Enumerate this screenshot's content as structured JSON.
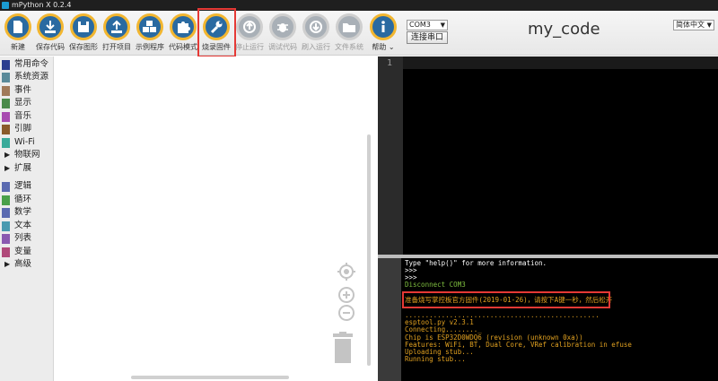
{
  "window": {
    "title": "mPython X 0.2.4"
  },
  "toolbar": {
    "buttons": [
      {
        "label": "新建",
        "icon": "new-file-icon",
        "enabled": true
      },
      {
        "label": "保存代码",
        "icon": "download-icon",
        "enabled": true
      },
      {
        "label": "保存图形",
        "icon": "floppy-icon",
        "enabled": true
      },
      {
        "label": "打开项目",
        "icon": "upload-icon",
        "enabled": true
      },
      {
        "label": "示例程序",
        "icon": "cubes-icon",
        "enabled": true
      },
      {
        "label": "代码模式",
        "icon": "puzzle-icon",
        "enabled": true
      },
      {
        "label": "烧录固件",
        "icon": "wrench-icon",
        "enabled": true
      },
      {
        "label": "停止运行",
        "icon": "upload-disabled-icon",
        "enabled": false
      },
      {
        "label": "调试代码",
        "icon": "bug-icon",
        "enabled": false
      },
      {
        "label": "刷入运行",
        "icon": "download-disabled-icon",
        "enabled": false
      },
      {
        "label": "文件系统",
        "icon": "folder-icon",
        "enabled": false
      },
      {
        "label": "帮助",
        "icon": "info-icon",
        "enabled": true
      }
    ],
    "port_value": "COM3",
    "connect_label": "连接串口",
    "file_name": "my_code",
    "language_value": "简体中文"
  },
  "sidebar": {
    "categories": [
      {
        "label": "常用命令",
        "color": "#2b3d8f",
        "expandable": false
      },
      {
        "label": "系统资源",
        "color": "#5a8a9a",
        "expandable": false
      },
      {
        "label": "事件",
        "color": "#a07a5a",
        "expandable": false
      },
      {
        "label": "显示",
        "color": "#4a8a4a",
        "expandable": false
      },
      {
        "label": "音乐",
        "color": "#a84ab0",
        "expandable": false
      },
      {
        "label": "引脚",
        "color": "#8a5a2a",
        "expandable": false
      },
      {
        "label": "Wi-Fi",
        "color": "#3aaa9a",
        "expandable": false
      },
      {
        "label": "物联网",
        "color": "",
        "expandable": true
      },
      {
        "label": "扩展",
        "color": "",
        "expandable": true
      },
      {
        "label": "逻辑",
        "color": "#5a6ab0",
        "expandable": false
      },
      {
        "label": "循环",
        "color": "#4aa04a",
        "expandable": false
      },
      {
        "label": "数学",
        "color": "#5a6ab0",
        "expandable": false
      },
      {
        "label": "文本",
        "color": "#4a9ab0",
        "expandable": false
      },
      {
        "label": "列表",
        "color": "#8a5ab0",
        "expandable": false
      },
      {
        "label": "变量",
        "color": "#b04a7a",
        "expandable": false
      },
      {
        "label": "高级",
        "color": "",
        "expandable": true
      }
    ]
  },
  "editor": {
    "line_number": "1"
  },
  "console": {
    "lines": [
      {
        "text": "Type \"help()\" for more information.",
        "color": "white"
      },
      {
        "text": ">>>",
        "color": "white"
      },
      {
        "text": ">>>",
        "color": "white"
      },
      {
        "text": "Disconnect COM3",
        "color": "green"
      },
      {
        "text": "",
        "color": "white"
      },
      {
        "text": "准备烧写掌控板官方固件(2019-01-26)，请按下A键一秒，然后松开",
        "color": "yellow"
      },
      {
        "text": "",
        "color": "white"
      },
      {
        "text": "................................................",
        "color": "yellow"
      },
      {
        "text": "esptool.py v2.3.1",
        "color": "yellow"
      },
      {
        "text": "Connecting........_",
        "color": "yellow"
      },
      {
        "text": "Chip is ESP32D0WDQ6 (revision (unknown 0xa))",
        "color": "yellow"
      },
      {
        "text": "Features: WiFi, BT, Dual Core, VRef calibration in efuse",
        "color": "yellow"
      },
      {
        "text": "Uploading stub...",
        "color": "yellow"
      },
      {
        "text": "Running stub...",
        "color": "yellow"
      }
    ]
  },
  "colors": {
    "accent": "#f2b630",
    "icon_fill": "#2a6aa1",
    "highlight": "#e53935"
  }
}
